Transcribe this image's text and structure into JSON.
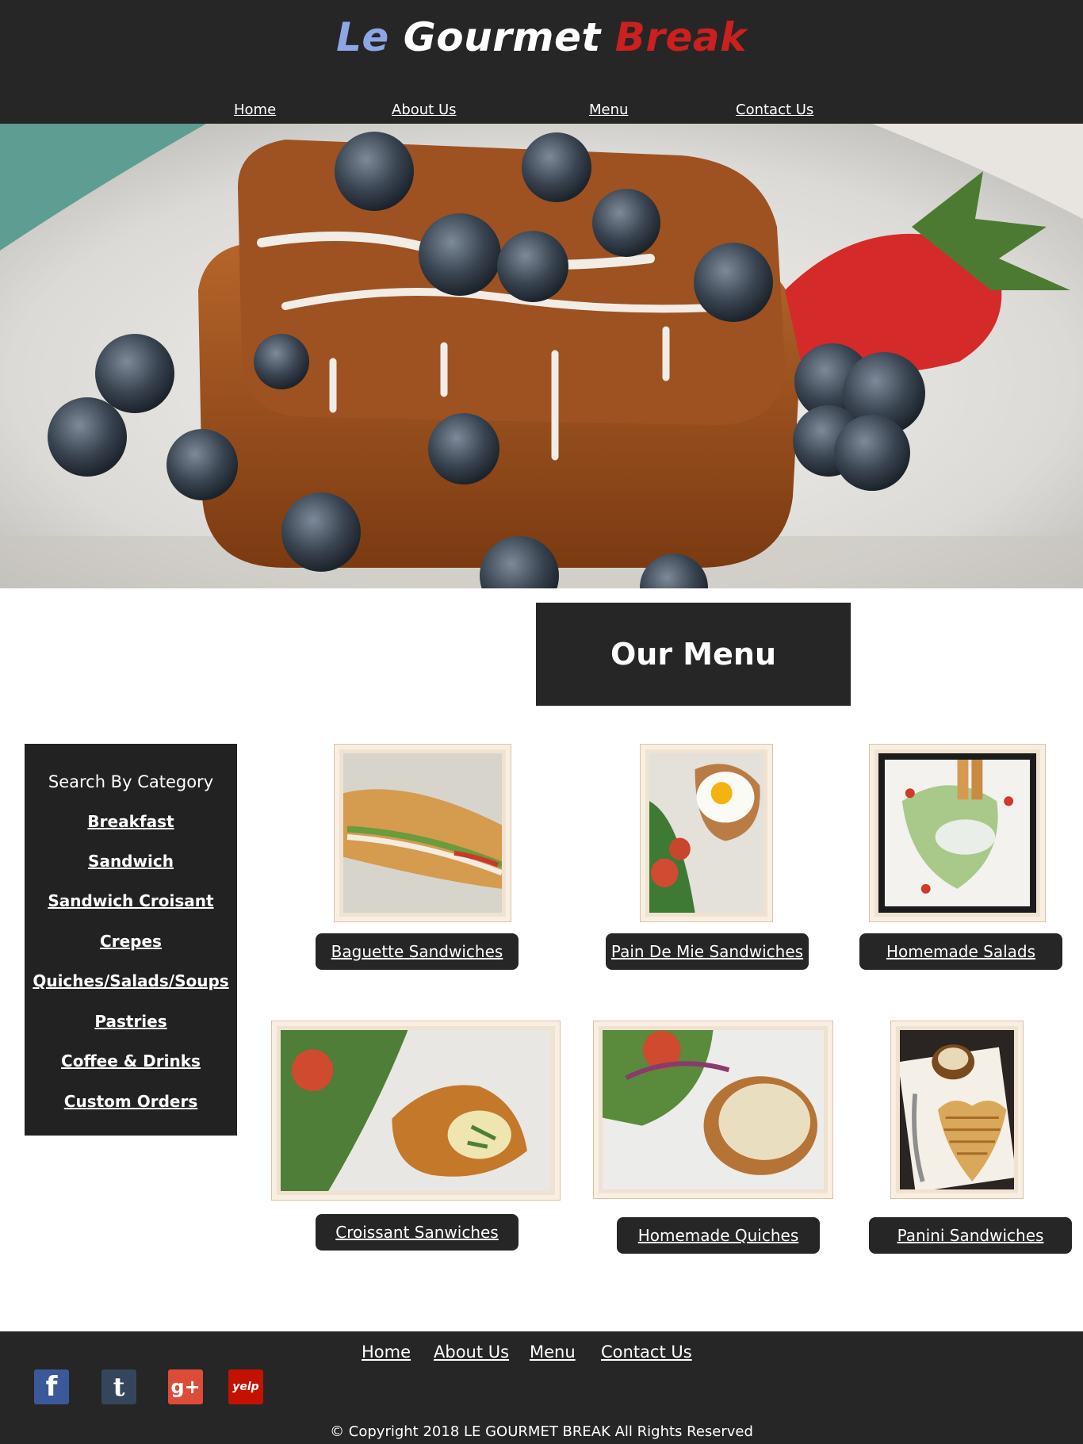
{
  "brand": {
    "word1": "Le",
    "word2": "Gourmet",
    "word3": "Break"
  },
  "nav": [
    {
      "label": "Home"
    },
    {
      "label": "About Us"
    },
    {
      "label": "Menu"
    },
    {
      "label": "Contact Us"
    }
  ],
  "hero": {
    "alt": "french-toast-photo"
  },
  "menu_title": "Our Menu",
  "sidebar": {
    "heading": "Search By Category",
    "items": [
      {
        "label": "Breakfast"
      },
      {
        "label": "Sandwich"
      },
      {
        "label": "Sandwich Croisant"
      },
      {
        "label": "Crepes"
      },
      {
        "label": "Quiches/Salads/Soups"
      },
      {
        "label": "Pastries"
      },
      {
        "label": "Coffee & Drinks"
      },
      {
        "label": "Custom Orders"
      }
    ]
  },
  "products": [
    {
      "label": "Baguette Sandwiches"
    },
    {
      "label": "Pain De Mie Sandwiches"
    },
    {
      "label": "Homemade Salads"
    },
    {
      "label": "Croissant Sanwiches"
    },
    {
      "label": "Homemade Quiches"
    },
    {
      "label": "Panini Sandwiches"
    }
  ],
  "footer": {
    "links": [
      {
        "label": "Home"
      },
      {
        "label": "About Us"
      },
      {
        "label": "Menu"
      },
      {
        "label": "Contact Us"
      }
    ],
    "social": [
      {
        "icon": "facebook-icon",
        "glyph": "f",
        "color": "#3b5998"
      },
      {
        "icon": "tumblr-icon",
        "glyph": "t",
        "color": "#35465c"
      },
      {
        "icon": "google-plus-icon",
        "glyph": "g+",
        "color": "#dd4b39"
      },
      {
        "icon": "yelp-icon",
        "glyph": "yelp",
        "color": "#c41200"
      }
    ],
    "copyright": "© Copyright 2018 LE GOURMET BREAK All Rights Reserved"
  },
  "colors": {
    "header_bg": "#262626",
    "accent_blue": "#8fa6e6",
    "accent_red": "#cc1f1f"
  }
}
